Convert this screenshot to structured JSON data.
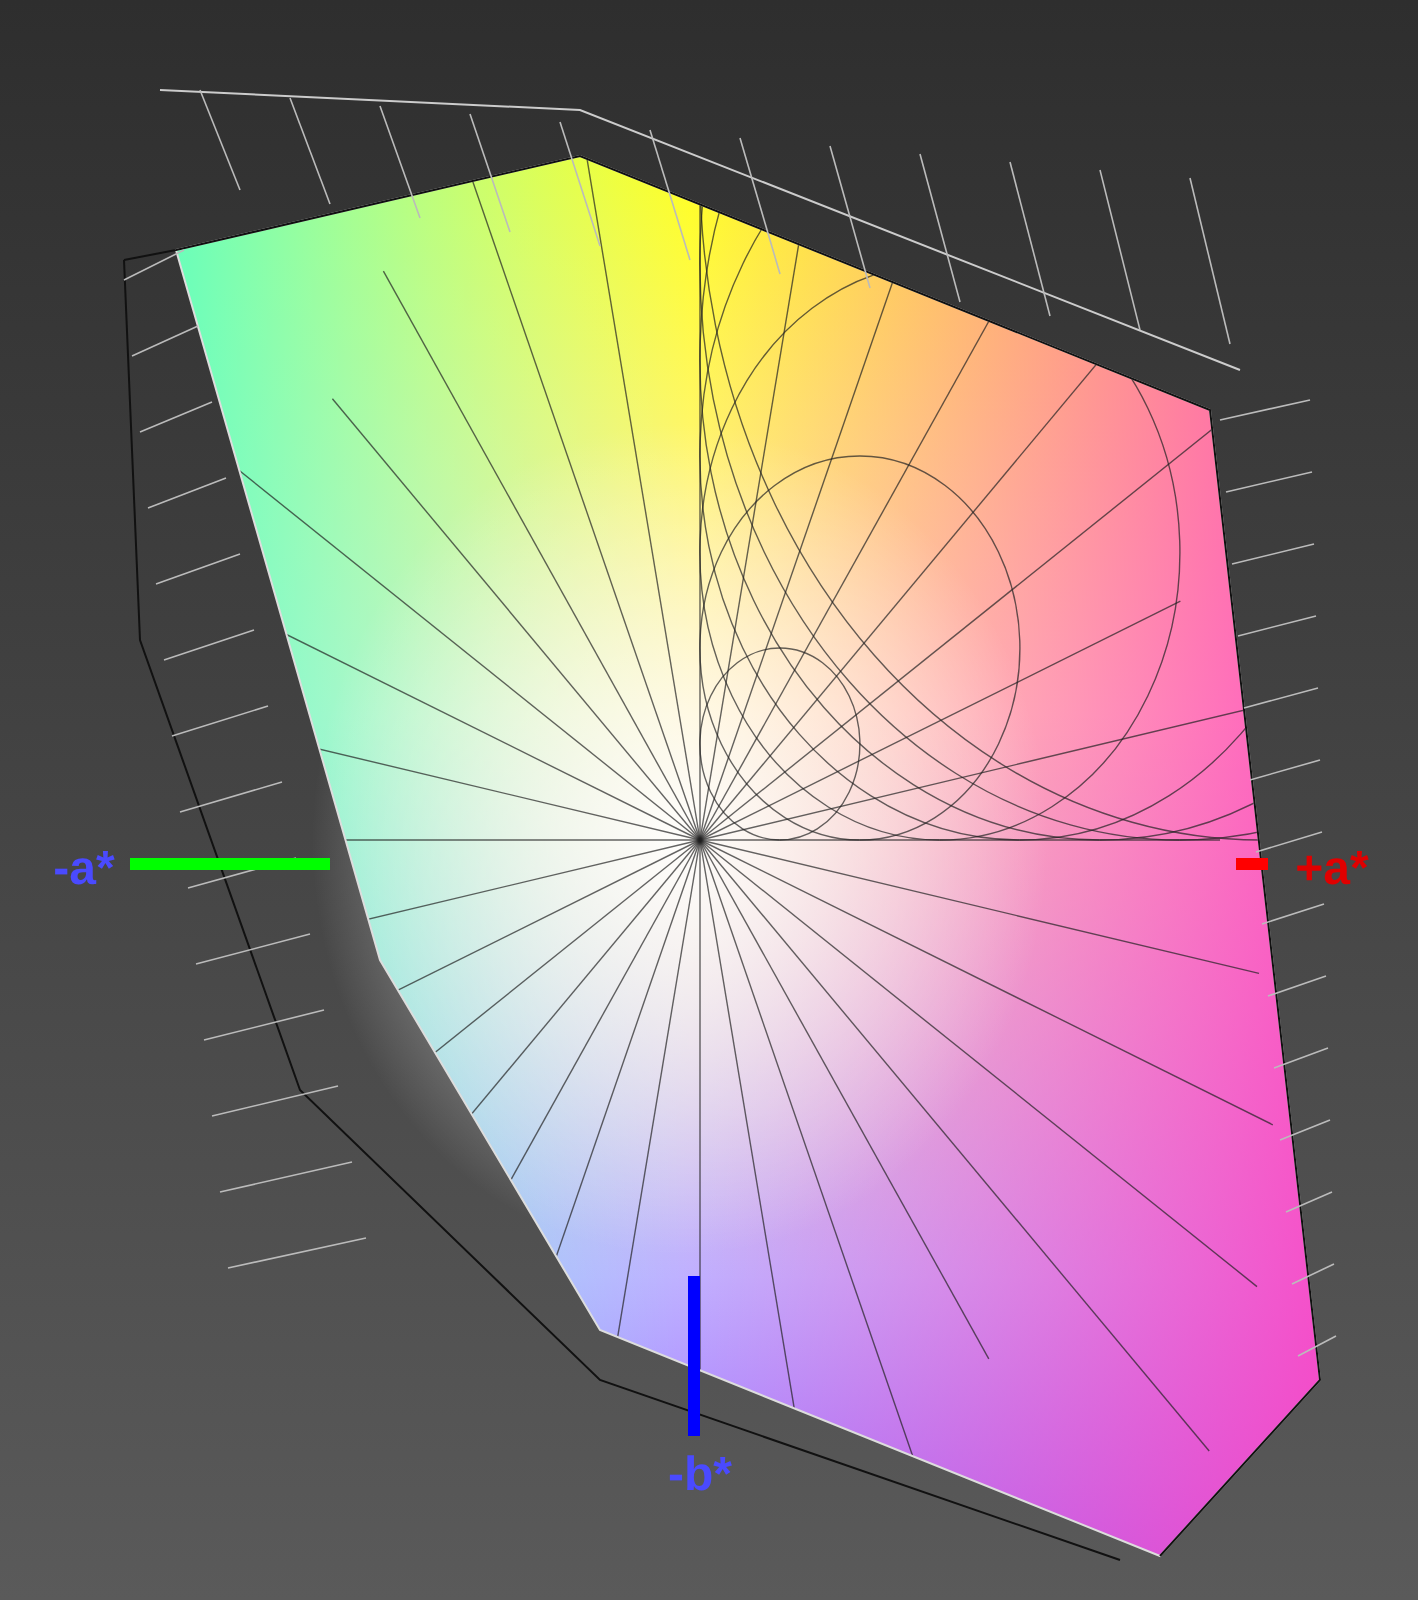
{
  "axes": [
    {
      "label": "-a*",
      "color": "#00ff00",
      "kind": "left"
    },
    {
      "label": "+a*",
      "color": "#ff0000",
      "kind": "right"
    },
    {
      "label": "-b*",
      "color": "#0000ff",
      "kind": "bottom"
    }
  ]
}
